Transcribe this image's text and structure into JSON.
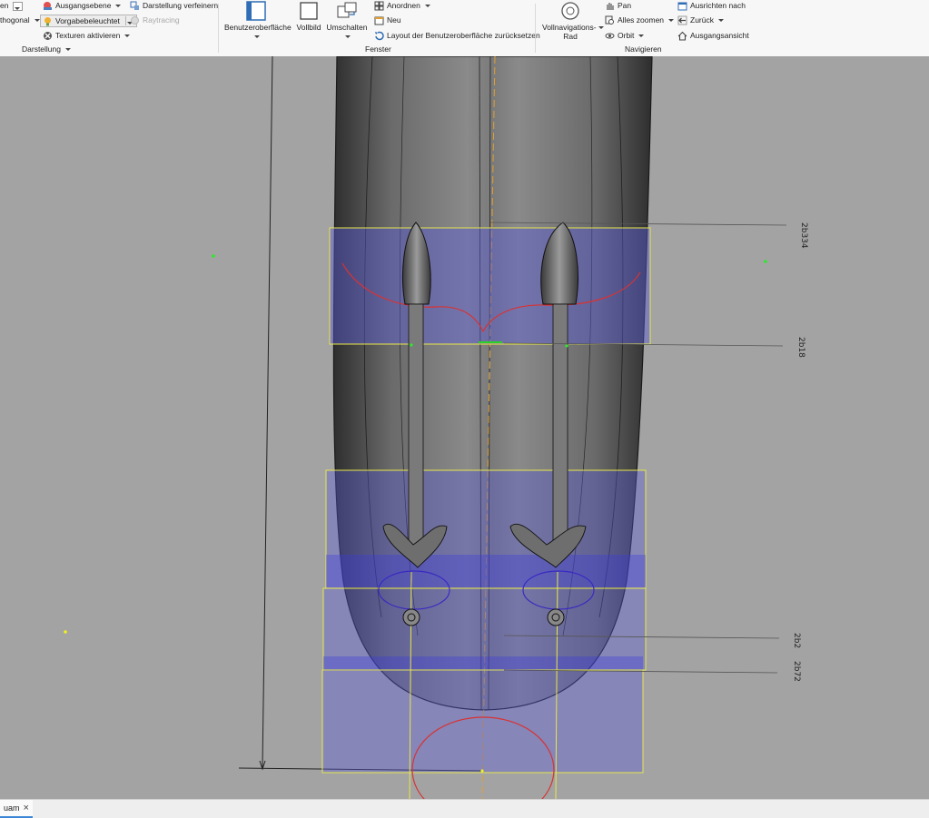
{
  "ribbon": {
    "darstellung": {
      "item_cut_top": "en",
      "ausgangsebene": "Ausgangsebene",
      "darstellung_verfeinern": "Darstellung verfeinern",
      "orthogonal": "thogonal",
      "vorgabebeleuchtet": "Vorgabebeleuchtet",
      "raytracing": "Raytracing",
      "texturen": "Texturen aktivieren",
      "group_label": "Darstellung"
    },
    "fenster": {
      "benutzeroberflaeche": "Benutzeroberfläche",
      "vollbild": "Vollbild",
      "umschalten": "Umschalten",
      "anordnen": "Anordnen",
      "neu": "Neu",
      "layout_reset": "Layout der Benutzeroberfläche zurücksetzen",
      "group_label": "Fenster"
    },
    "navigieren": {
      "vollnavigationsrad_line1": "Vollnavigations-",
      "vollnavigationsrad_line2": "Rad",
      "pan": "Pan",
      "alles_zoomen": "Alles zoomen",
      "orbit": "Orbit",
      "ausrichten_nach": "Ausrichten nach",
      "zurueck": "Zurück",
      "ausgangsansicht": "Ausgangsansicht",
      "group_label": "Navigieren"
    }
  },
  "viewport": {
    "dimensions": [
      "2b334",
      "2b18",
      "2b2",
      "2b72"
    ],
    "colors": {
      "background": "#a3a3a3",
      "body": "#5c5c5c",
      "selection_fill": "#5a5ad8",
      "selection_edge": "#e8e84a",
      "sketch_red": "#d83232",
      "axis_orange": "#e0a030"
    }
  },
  "document_tabs": [
    {
      "label": "uam",
      "close": "×"
    }
  ]
}
